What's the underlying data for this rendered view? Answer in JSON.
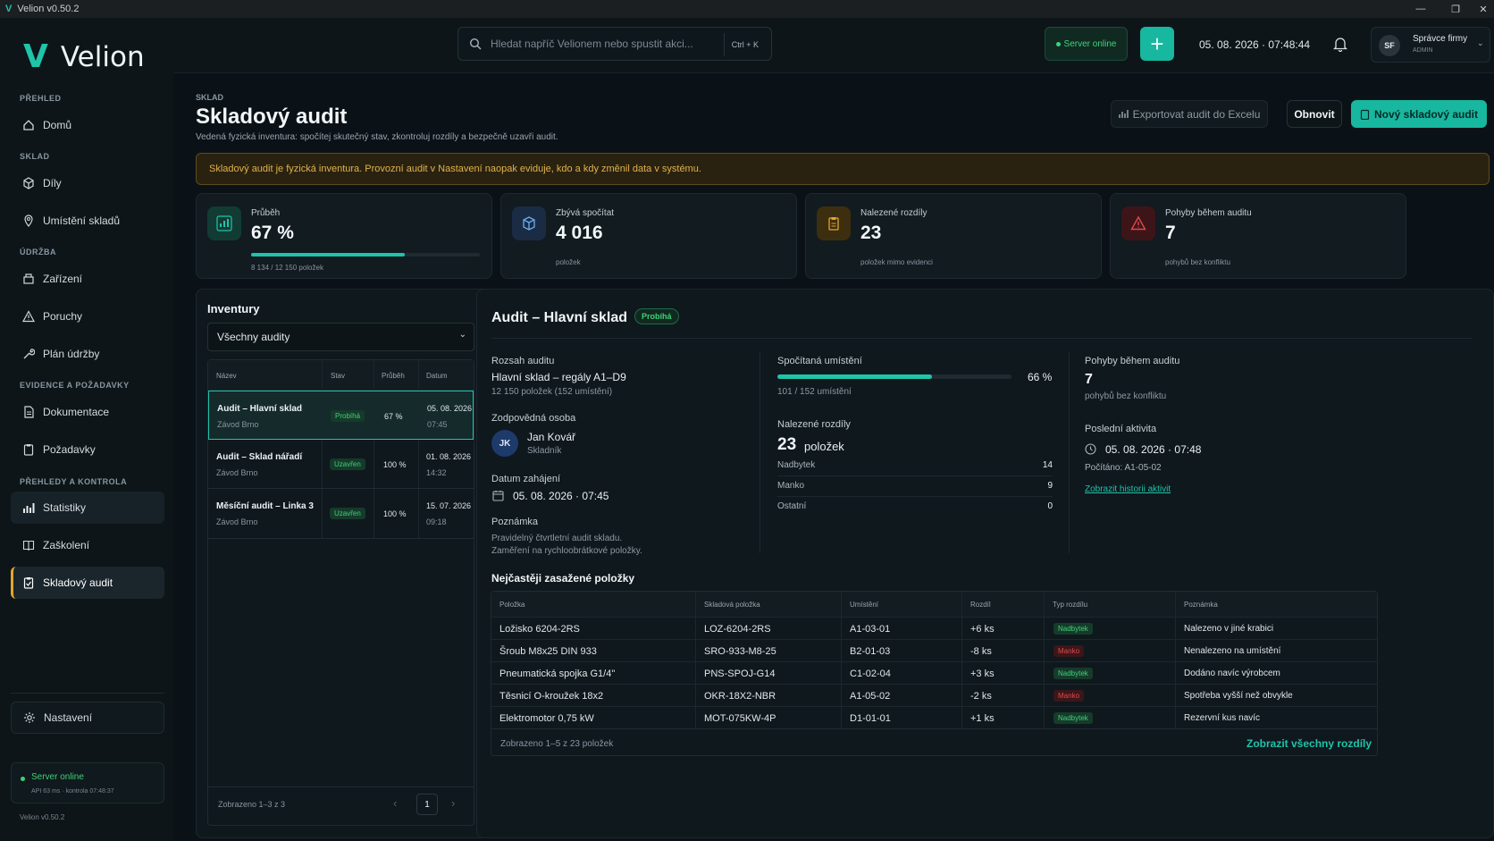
{
  "window": {
    "title": "Velion v0.50.2"
  },
  "app": {
    "name": "Velion",
    "version": "Velion v0.50.2"
  },
  "sidebar": {
    "sections": [
      "PŘEHLED",
      "SKLAD",
      "ÚDRŽBA",
      "EVIDENCE A POŽADAVKY",
      "PŘEHLEDY A KONTROLA"
    ],
    "items": [
      {
        "label": "Domů",
        "icon": "home-icon"
      },
      {
        "label": "Díly",
        "icon": "cube-icon"
      },
      {
        "label": "Umístění skladů",
        "icon": "pin-icon"
      },
      {
        "label": "Zařízení",
        "icon": "machine-icon"
      },
      {
        "label": "Poruchy",
        "icon": "warning-icon"
      },
      {
        "label": "Plán údržby",
        "icon": "wrench-icon"
      },
      {
        "label": "Dokumentace",
        "icon": "document-icon"
      },
      {
        "label": "Požadavky",
        "icon": "clipboard-icon"
      },
      {
        "label": "Statistiky",
        "icon": "chart-icon"
      },
      {
        "label": "Zaškolení",
        "icon": "book-icon"
      },
      {
        "label": "Skladový audit",
        "icon": "clipboard-check-icon"
      }
    ],
    "settings": "Nastavení",
    "server_status": "Server online",
    "server_detail": "API 63 ms · kontrola 07:48:37"
  },
  "topbar": {
    "search_placeholder": "Hledat napříč Velionem nebo spustit akci...",
    "shortcut": "Ctrl + K",
    "server": "Server online",
    "datetime": "05. 08. 2026  ·  07:48:44",
    "user_initials": "SF",
    "user_name": "Správce firmy",
    "user_role": "ADMIN"
  },
  "page": {
    "breadcrumb": "SKLAD",
    "title": "Skladový audit",
    "subtitle": "Vedená fyzická inventura: spočítej skutečný stav, zkontroluj rozdíly a bezpečně uzavři audit.",
    "export_label": "Exportovat audit do Excelu",
    "refresh_label": "Obnovit",
    "new_label": "Nový skladový audit",
    "alert": "Skladový audit je fyzická inventura. Provozní audit v Nastavení naopak eviduje, kdo a kdy změnil data v systému."
  },
  "cards": [
    {
      "label": "Průběh",
      "value": "67 %",
      "sub": "8 134 / 12 150 položek",
      "progress": 0.67,
      "color": "#1fc4a9"
    },
    {
      "label": "Zbývá spočítat",
      "value": "4 016",
      "sub": "položek",
      "color": "#4f9be0"
    },
    {
      "label": "Nalezené rozdíly",
      "value": "23",
      "sub": "položek mimo evidenci",
      "color": "#e0a72c"
    },
    {
      "label": "Pohyby během auditu",
      "value": "7",
      "sub": "pohybů bez konfliktu",
      "color": "#e0484e"
    }
  ],
  "inventory": {
    "title": "Inventury",
    "filter": "Všechny audity",
    "columns": [
      "Název",
      "Stav",
      "Průběh",
      "Datum"
    ],
    "rows": [
      {
        "name": "Audit – Hlavní sklad",
        "place": "Závod Brno",
        "status": "Probíhá",
        "progress": "67 %",
        "date": "05. 08. 2026",
        "time": "07:45"
      },
      {
        "name": "Audit – Sklad nářadí",
        "place": "Závod Brno",
        "status": "Uzavřen",
        "progress": "100 %",
        "date": "01. 08. 2026",
        "time": "14:32"
      },
      {
        "name": "Měsíční audit – Linka 3",
        "place": "Závod Brno",
        "status": "Uzavřen",
        "progress": "100 %",
        "date": "15. 07. 2026",
        "time": "09:18"
      }
    ],
    "footer": "Zobrazeno 1–3 z 3",
    "page": "1"
  },
  "detail": {
    "title": "Audit – Hlavní sklad",
    "status": "Probíhá",
    "scope_label": "Rozsah auditu",
    "scope_value": "Hlavní sklad – regály A1–D9",
    "scope_sub": "12 150 položek (152 umístění)",
    "owner_label": "Zodpovědná osoba",
    "owner_initials": "JK",
    "owner_name": "Jan Kovář",
    "owner_role": "Skladník",
    "start_label": "Datum zahájení",
    "start_value": "05. 08. 2026  ·  07:45",
    "note_label": "Poznámka",
    "note_line1": "Pravidelný čtvrtletní audit skladu.",
    "note_line2": "Zaměření na rychloobrátkové položky.",
    "counted_label": "Spočítaná umístění",
    "counted_pct": "66 %",
    "counted_progress": 0.66,
    "counted_sub": "101 / 152 umístění",
    "diffs_label": "Nalezené rozdíly",
    "diffs_value": "23",
    "diffs_unit": "položek",
    "breakdown": [
      {
        "label": "Nadbytek",
        "value": "14"
      },
      {
        "label": "Manko",
        "value": "9"
      },
      {
        "label": "Ostatní",
        "value": "0"
      }
    ],
    "moves_label": "Pohyby během auditu",
    "moves_value": "7",
    "moves_sub": "pohybů bez konfliktu",
    "last_label": "Poslední aktivita",
    "last_value": "05. 08. 2026  ·  07:48",
    "last_sub": "Počítáno: A1-05-02",
    "history_link": "Zobrazit historii aktivit"
  },
  "affected": {
    "title": "Nejčastěji zasažené položky",
    "columns": [
      "Položka",
      "Skladová položka",
      "Umístění",
      "Rozdíl",
      "Typ rozdílu",
      "Poznámka"
    ],
    "rows": [
      {
        "item": "Ložisko 6204-2RS",
        "sku": "LOZ-6204-2RS",
        "loc": "A1-03-01",
        "diff": "+6 ks",
        "type": "Nadbytek",
        "note": "Nalezeno v jiné krabici"
      },
      {
        "item": "Šroub M8x25 DIN 933",
        "sku": "SRO-933-M8-25",
        "loc": "B2-01-03",
        "diff": "-8 ks",
        "type": "Manko",
        "note": "Nenalezeno na umístění"
      },
      {
        "item": "Pneumatická spojka G1/4\"",
        "sku": "PNS-SPOJ-G14",
        "loc": "C1-02-04",
        "diff": "+3 ks",
        "type": "Nadbytek",
        "note": "Dodáno navíc výrobcem"
      },
      {
        "item": "Těsnicí O-kroužek 18x2",
        "sku": "OKR-18X2-NBR",
        "loc": "A1-05-02",
        "diff": "-2 ks",
        "type": "Manko",
        "note": "Spotřeba vyšší než obvykle"
      },
      {
        "item": "Elektromotor 0,75 kW",
        "sku": "MOT-075KW-4P",
        "loc": "D1-01-01",
        "diff": "+1 ks",
        "type": "Nadbytek",
        "note": "Rezervní kus navíc"
      }
    ],
    "footer": "Zobrazeno 1–5 z 23 položek",
    "show_all": "Zobrazit všechny rozdíly"
  },
  "colors": {
    "accent": "#1fc4a9",
    "warning": "#e0a72c",
    "danger": "#e0484e",
    "success": "#3fd07a"
  }
}
